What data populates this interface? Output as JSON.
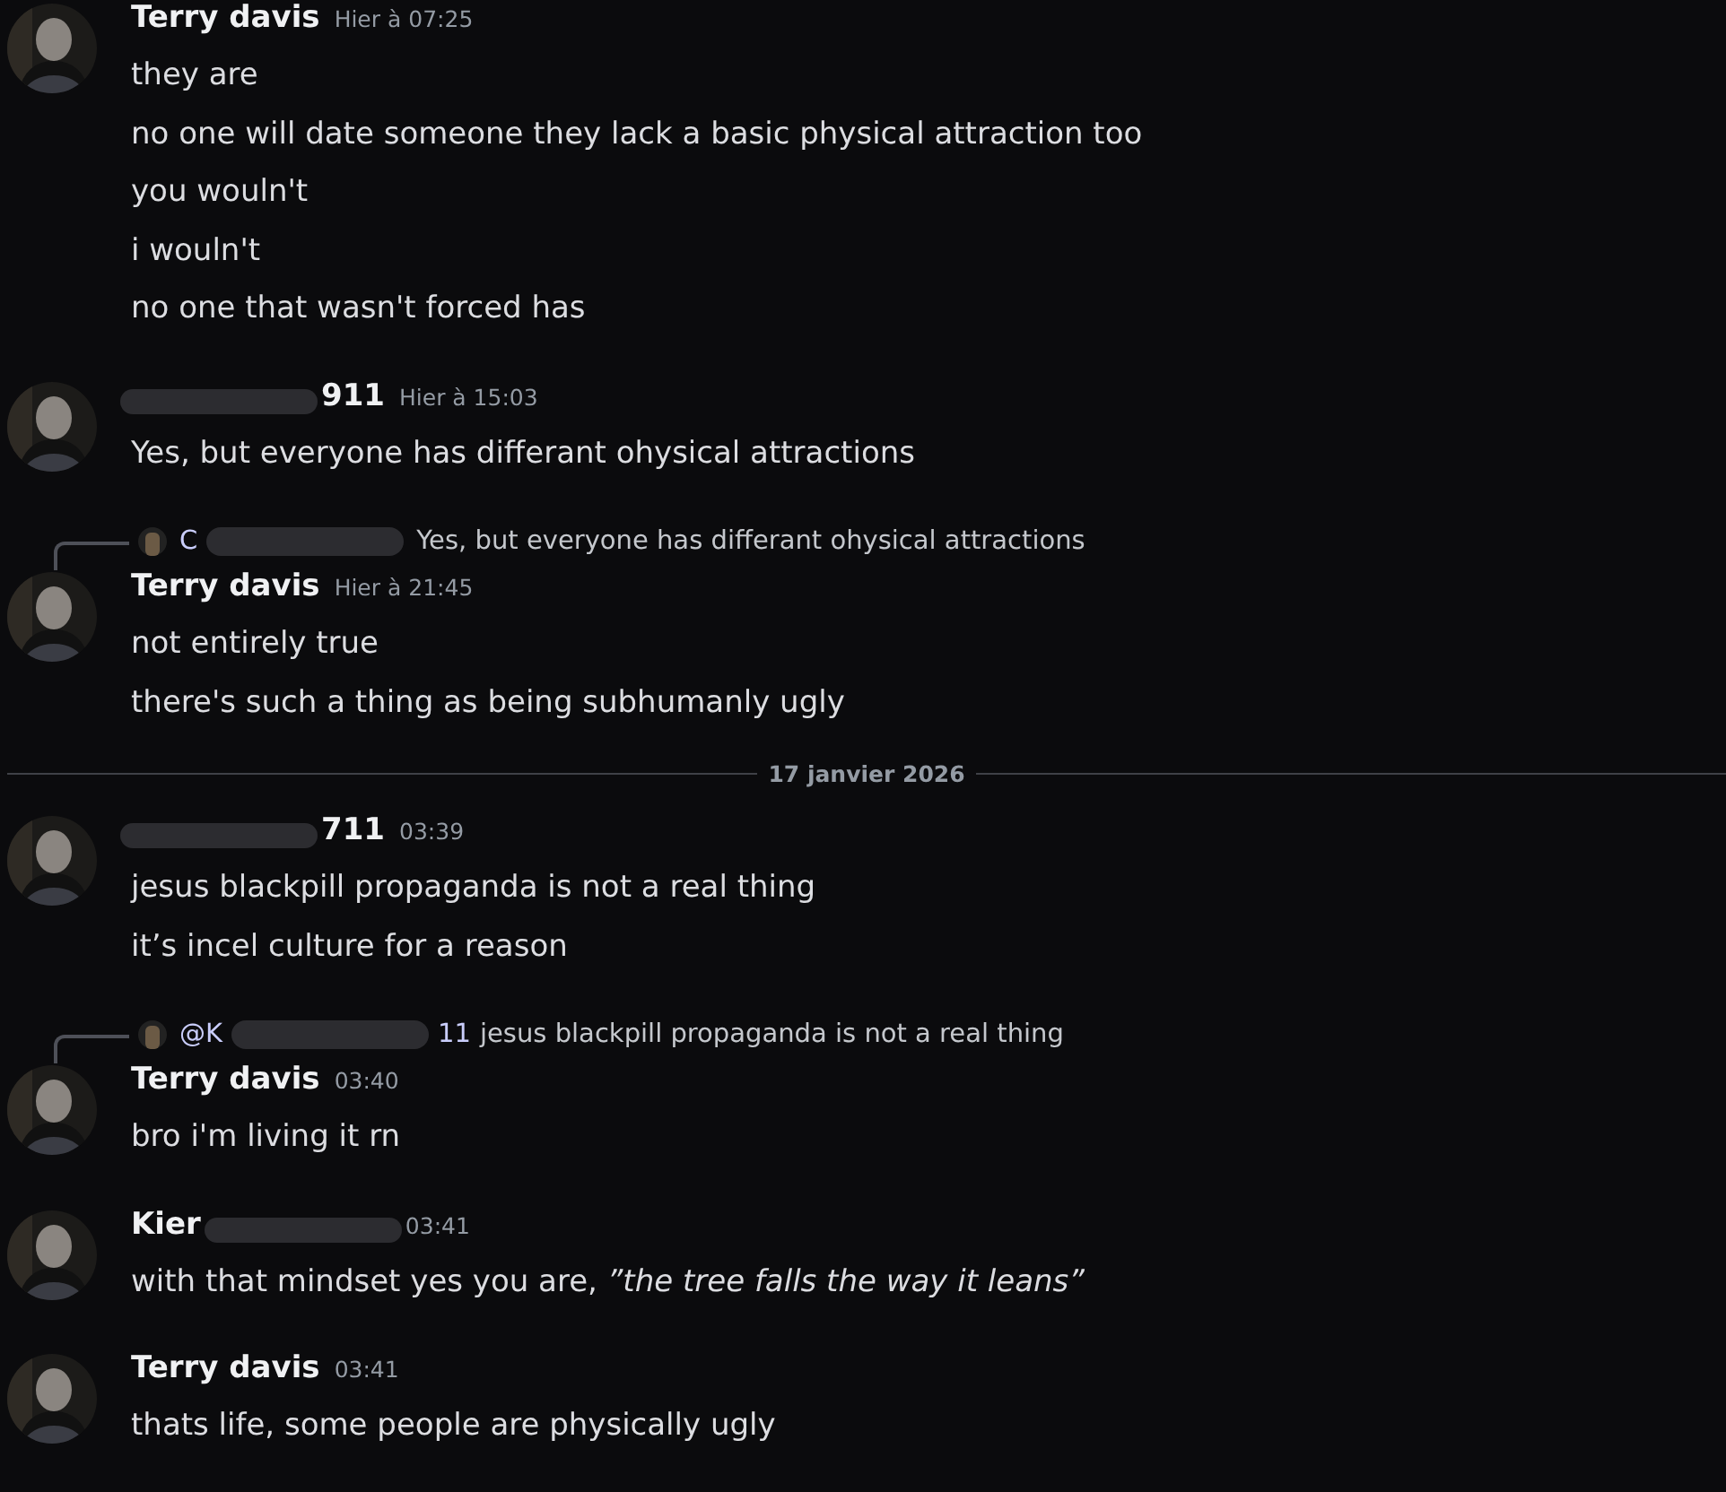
{
  "feed": [
    {
      "kind": "group",
      "author": {
        "name_start": "Terry davis",
        "redacted": false
      },
      "time": "Hier à 07:25",
      "messages": [
        {
          "text": "they are"
        },
        {
          "text": "no one will date someone they lack a basic physical attraction too"
        },
        {
          "text": "you wouln't"
        },
        {
          "text": "i wouln't"
        },
        {
          "text": "no one that wasn't forced has"
        }
      ]
    },
    {
      "kind": "group",
      "author": {
        "name_end": "911",
        "redacted": true
      },
      "time": "Hier à 15:03",
      "messages": [
        {
          "text": "Yes, but everyone has differant ohysical attractions"
        }
      ]
    },
    {
      "kind": "group",
      "reply": {
        "mention_start": "C",
        "text": "Yes, but everyone has differant ohysical attractions"
      },
      "author": {
        "name_start": "Terry davis",
        "redacted": false
      },
      "time": "Hier à 21:45",
      "messages": [
        {
          "text": "not entirely true"
        },
        {
          "text": "there's such a thing as being subhumanly ugly"
        }
      ]
    },
    {
      "kind": "divider",
      "label": "17 janvier 2026"
    },
    {
      "kind": "group",
      "author": {
        "name_end": "711",
        "redacted": true
      },
      "time": "03:39",
      "messages": [
        {
          "text": "jesus blackpill propaganda is not a real thing"
        },
        {
          "text": "it’s incel culture for a reason"
        }
      ]
    },
    {
      "kind": "group",
      "reply": {
        "mention_start": "@K",
        "mention_end": "11",
        "text": "jesus blackpill propaganda is not a real thing"
      },
      "author": {
        "name_start": "Terry davis",
        "redacted": false
      },
      "time": "03:40",
      "messages": [
        {
          "text": "bro i'm living it rn"
        }
      ]
    },
    {
      "kind": "group",
      "author": {
        "name_start": "Kier",
        "redacted": true
      },
      "time": "03:41",
      "messages": [
        {
          "text": "with that mindset yes you are, *”the tree falls the way it leans”*"
        }
      ]
    },
    {
      "kind": "group",
      "author": {
        "name_start": "Terry davis",
        "redacted": false
      },
      "time": "03:41",
      "messages": [
        {
          "text": "thats life, some people are physically ugly"
        }
      ]
    }
  ]
}
